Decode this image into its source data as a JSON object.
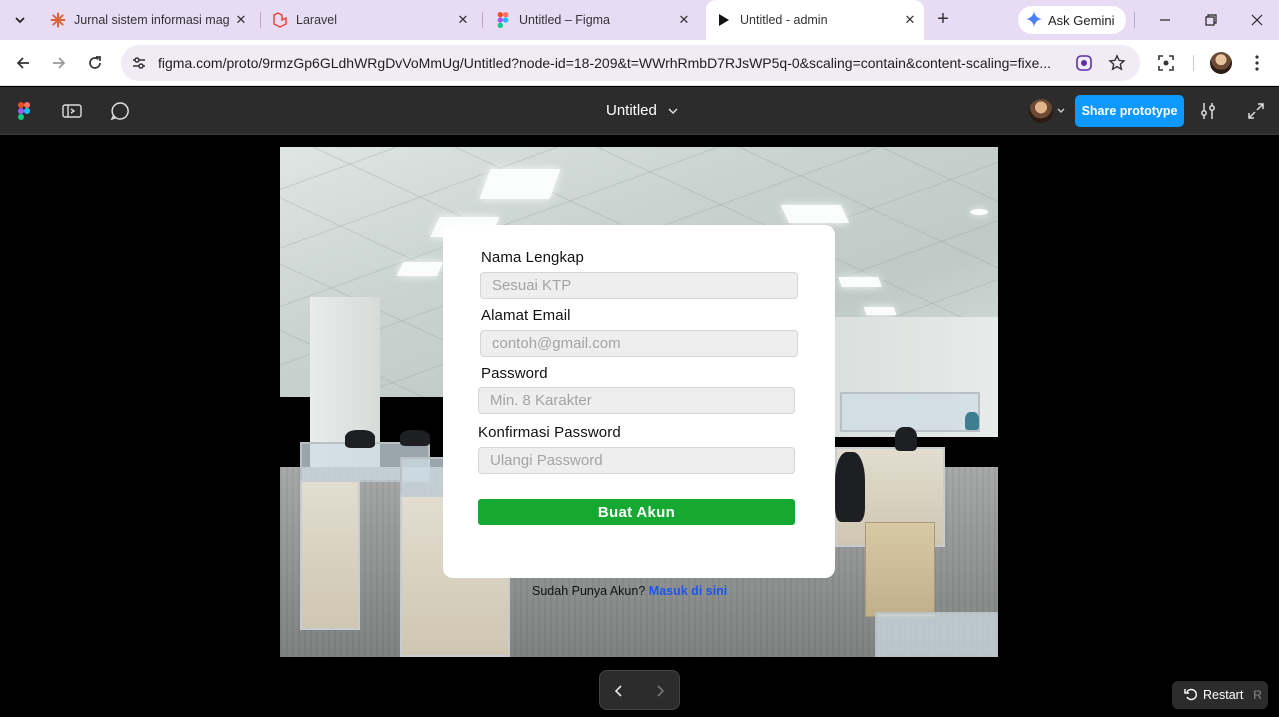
{
  "browser": {
    "tabs": [
      {
        "title": "Jurnal sistem informasi mag",
        "favicon": "asterisk-icon",
        "active": false
      },
      {
        "title": "Laravel",
        "favicon": "laravel-icon",
        "active": false
      },
      {
        "title": "Untitled – Figma",
        "favicon": "figma-icon",
        "active": false
      },
      {
        "title": "Untitled - admin",
        "favicon": "play-icon",
        "active": true
      }
    ],
    "new_tab": "+",
    "gemini_label": "Ask Gemini",
    "url": "figma.com/proto/9rmzGp6GLdhWRgDvVoMmUg/Untitled?node-id=18-209&t=WWrhRmbD7RJsWP5q-0&scaling=contain&content-scaling=fixe..."
  },
  "figma": {
    "file_title": "Untitled",
    "share_label": "Share prototype",
    "restart_label": "Restart",
    "restart_key": "R"
  },
  "form": {
    "fields": [
      {
        "label": "Nama Lengkap",
        "placeholder": "Sesuai KTP"
      },
      {
        "label": "Alamat Email",
        "placeholder": "contoh@gmail.com"
      },
      {
        "label": "Password",
        "placeholder": "Min. 8 Karakter"
      },
      {
        "label": "Konfirmasi Password",
        "placeholder": "Ulangi Password"
      }
    ],
    "submit_label": "Buat Akun",
    "login_prompt": "Sudah Punya Akun?",
    "login_link": "Masuk di sini"
  },
  "colors": {
    "submit": "#16a932",
    "link": "#1a56f0",
    "share": "#0d99ff",
    "figma_bar": "#2c2c2c",
    "tab_strip": "#e8dcf5"
  }
}
